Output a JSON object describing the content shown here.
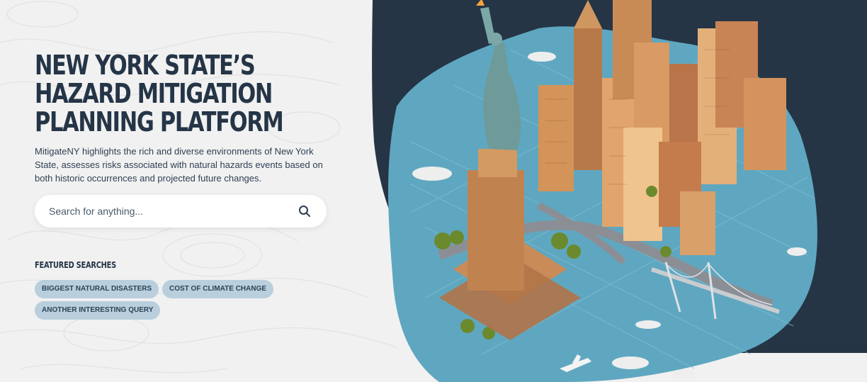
{
  "hero": {
    "title_lines": [
      "NEW YORK STATE’S",
      "HAZARD MITIGATION",
      "PLANNING PLATFORM"
    ],
    "description": "MitigateNY highlights the rich and diverse environments of New York State, assesses risks associated with natural hazards events based on both historic occurrences and projected future changes."
  },
  "search": {
    "placeholder": "Search for anything...",
    "icon": "search-icon"
  },
  "featured": {
    "heading": "FEATURED SEARCHES",
    "chips": [
      "BIGGEST NATURAL DISASTERS",
      "COST OF CLIMATE CHANGE",
      "ANOTHER INTERESTING QUERY"
    ]
  },
  "illustration": {
    "subject": "Isometric New York City illustration with the Statue of Liberty, skyscrapers, bridge, boats and water",
    "icon": "nyc-illustration"
  },
  "colors": {
    "background": "#f1f1f1",
    "panel_dark": "#253545",
    "title": "#253547",
    "chip": "#b9cfdd",
    "water": "#5fa7c0"
  }
}
